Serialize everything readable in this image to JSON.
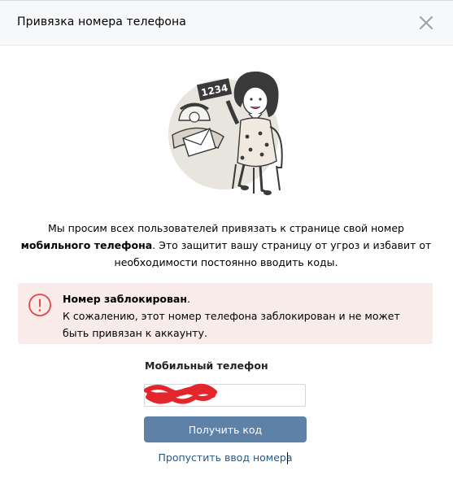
{
  "dialog": {
    "title": "Привязка номера телефона",
    "close_icon": "close-icon"
  },
  "illustration": {
    "icon": "woman-with-phone-number-sign-illustration",
    "sign_text": "1234"
  },
  "intro": {
    "part1": "Мы просим всех пользователей привязать к странице свой номер ",
    "bold1": "мобильного телефона",
    "part2": ". Это защитит вашу страницу от угроз и избавит от необходимости постоянно вводить коды."
  },
  "alert": {
    "icon": "exclamation-circle-icon",
    "title": "Номер заблокирован",
    "title_suffix": ".",
    "message": "К сожалению, этот номер телефона заблокирован и не может быть привязан к аккаунту."
  },
  "form": {
    "phone_label": "Мобильный телефон",
    "phone_value": "",
    "submit_label": "Получить код",
    "skip_label": "Пропустить ввод номера"
  },
  "colors": {
    "header_bg": "#f7f8fa",
    "alert_bg": "#f8ebea",
    "alert_icon": "#e64646",
    "button_bg": "#5e81a8",
    "link": "#2a5885",
    "redaction": "#e3262b"
  }
}
